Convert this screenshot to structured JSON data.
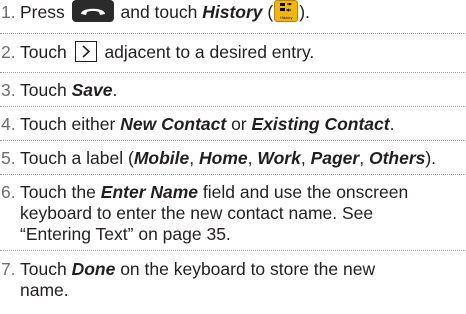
{
  "steps": [
    {
      "number": "1.",
      "parts": {
        "a": "Press",
        "b": "and touch",
        "history": "History",
        "open": "(",
        "close": ")."
      },
      "icons": {
        "call": "talk-key-icon",
        "history": "history-icon"
      },
      "history_icon_label": "History"
    },
    {
      "number": "2.",
      "parts": {
        "a": "Touch",
        "b": "adjacent to a desired entry."
      },
      "icons": {
        "chevron": "chevron-right-icon"
      }
    },
    {
      "number": "3.",
      "parts": {
        "a": "Touch",
        "save": "Save",
        "end": "."
      }
    },
    {
      "number": "4.",
      "parts": {
        "a": "Touch either",
        "new_contact": "New Contact",
        "or": "or",
        "existing_contact": "Existing Contact",
        "end": "."
      }
    },
    {
      "number": "5.",
      "parts": {
        "a": "Touch a label (",
        "mobile": "Mobile",
        "home": "Home",
        "work": "Work",
        "pager": "Pager",
        "others": "Others",
        "sep": ",",
        "end": ")."
      }
    },
    {
      "number": "6.",
      "parts": {
        "a": "Touch the",
        "enter_name": "Enter Name",
        "b": "field and use the onscreen",
        "line2": "keyboard to enter the new contact name. See",
        "line3": "“Entering Text” on page 35."
      }
    },
    {
      "number": "7.",
      "parts": {
        "a": "Touch",
        "done": "Done",
        "b": "on the keyboard to store the new",
        "line2": "name."
      }
    }
  ],
  "colors": {
    "text": "#231f20",
    "number": "#6d6e71",
    "rule": "#9a9a9a",
    "history_icon": "#f2b705",
    "call_icon": "#2b2b2b"
  }
}
